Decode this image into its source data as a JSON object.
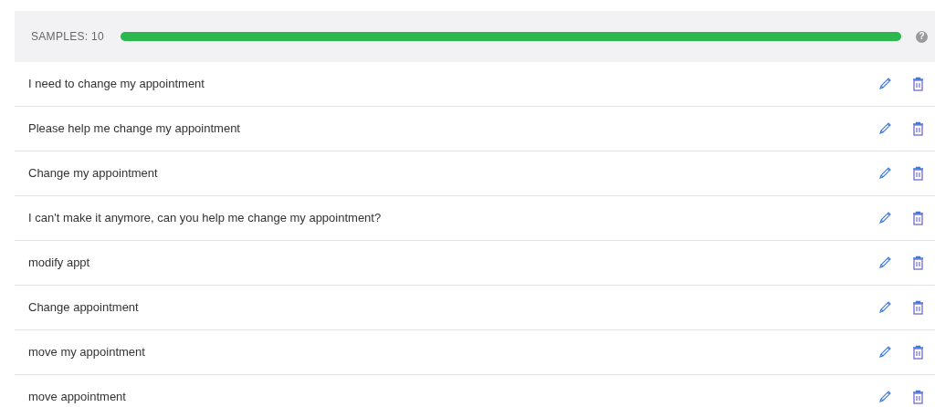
{
  "samples_header": {
    "label": "SAMPLES: 10",
    "level": 1,
    "help_icon": "?"
  },
  "samples": [
    {
      "text": "I need to change my appointment"
    },
    {
      "text": "Please help me change my appointment"
    },
    {
      "text": "Change my appointment"
    },
    {
      "text": "I can't make it anymore, can you help me change my appointment?"
    },
    {
      "text": "modify appt"
    },
    {
      "text": "Change appointment"
    },
    {
      "text": "move my appointment"
    },
    {
      "text": "move appointment"
    }
  ]
}
